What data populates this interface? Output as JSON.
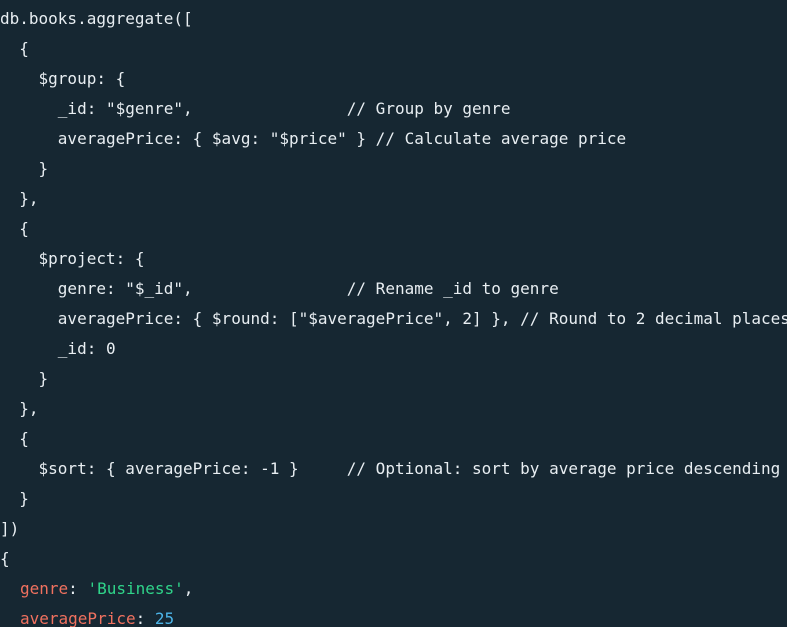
{
  "colors": {
    "background": "#162732",
    "text": "#e8eef2",
    "output_key": "#f0715f",
    "output_string": "#2fd48a",
    "output_number": "#4cb4e8"
  },
  "query_lines": [
    "db.books.aggregate([",
    "  {",
    "    $group: {",
    "      _id: \"$genre\",                // Group by genre",
    "      averagePrice: { $avg: \"$price\" } // Calculate average price",
    "    }",
    "  },",
    "  {",
    "    $project: {",
    "      genre: \"$_id\",                // Rename _id to genre",
    "      averagePrice: { $round: [\"$averagePrice\", 2] }, // Round to 2 decimal places",
    "      _id: 0",
    "    }",
    "  },",
    "  {",
    "    $sort: { averagePrice: -1 }     // Optional: sort by average price descending",
    "  }",
    "])"
  ],
  "result": {
    "open_brace": "{",
    "genre_key": "genre",
    "genre_value": "'Business'",
    "average_price_key": "averagePrice",
    "average_price_value": "25",
    "colon": ": ",
    "comma": ","
  }
}
